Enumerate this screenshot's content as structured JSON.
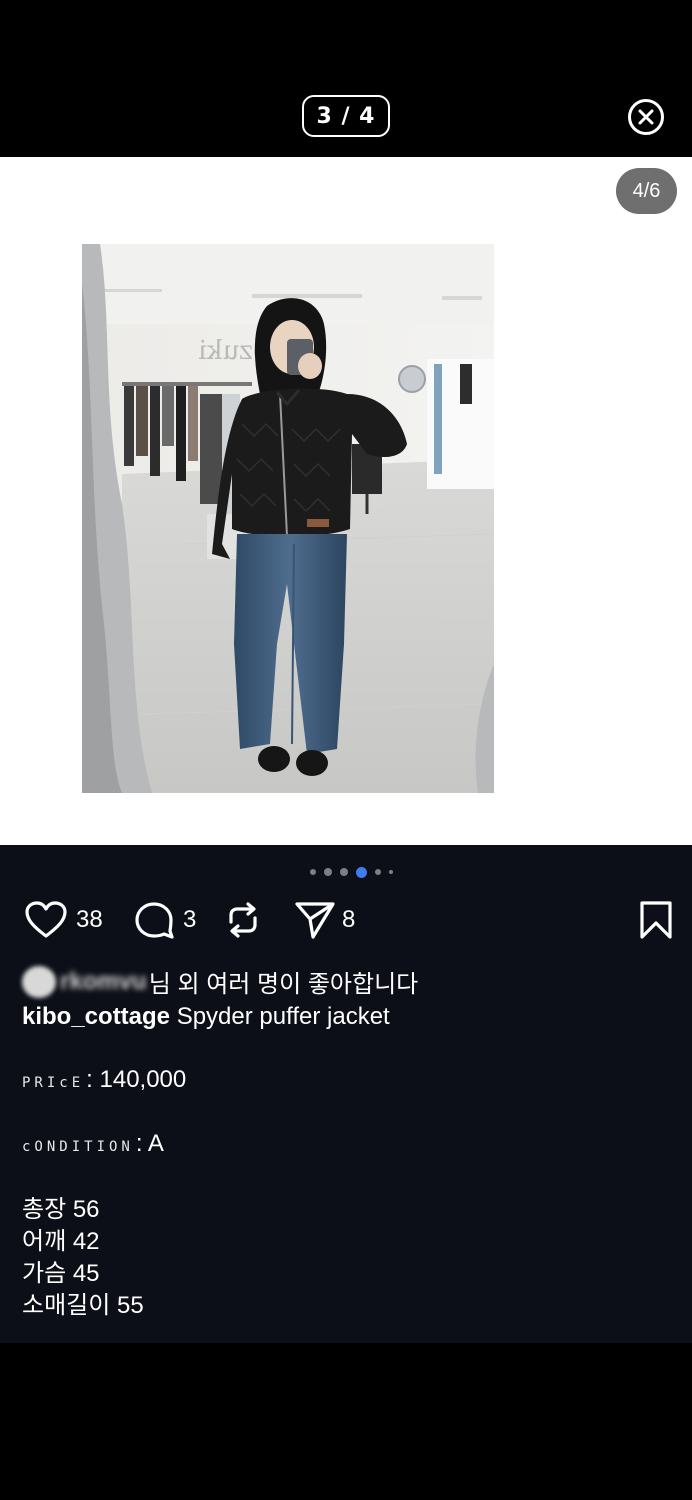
{
  "viewer": {
    "counter": "3 / 4",
    "close_icon": "close-circle-icon"
  },
  "photo": {
    "count_badge": "4/6",
    "store_sign": "sozuki"
  },
  "carousel": {
    "dots": 6,
    "active_index": 3
  },
  "actions": {
    "likes": "38",
    "comments": "3",
    "shares": "8",
    "icons": [
      "heart-icon",
      "comment-icon",
      "repost-icon",
      "send-icon",
      "bookmark-icon"
    ]
  },
  "post": {
    "liked_by_user": "rkomvu",
    "liked_by_suffix": "님 외 여러 명이 좋아합니다",
    "username": "kibo_cottage",
    "title": "Spyder puffer jacket",
    "price_label": "PRIcE",
    "price_value": ": 140,000",
    "condition_label": "cONDITION",
    "condition_value": ": A",
    "sizes": [
      "총장 56",
      "어깨 42",
      "가슴 45",
      "소매길이 55"
    ]
  },
  "colors": {
    "post_bg": "#0c0f17",
    "active_dot": "#3f7cf0"
  }
}
